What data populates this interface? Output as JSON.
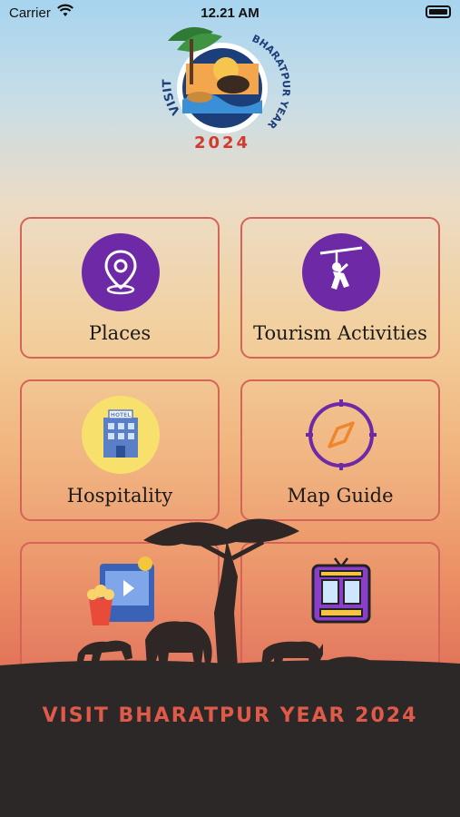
{
  "status_bar": {
    "carrier": "Carrier",
    "time": "12.21 AM"
  },
  "logo": {
    "text_arc": "VISIT BHARATPUR YEAR",
    "year": "2024",
    "icon": "bharatpur-logo"
  },
  "tiles": [
    {
      "label": "Places",
      "icon": "location-pin-icon"
    },
    {
      "label": "Tourism Activities",
      "icon": "zipline-icon"
    },
    {
      "label": "Hospitality",
      "icon": "hotel-icon"
    },
    {
      "label": "Map Guide",
      "icon": "compass-icon"
    },
    {
      "label": "",
      "icon": "entertainment-icon"
    },
    {
      "label": "",
      "icon": "bus-icon"
    }
  ],
  "footer": {
    "title": "VISIT BHARATPUR YEAR 2024"
  },
  "colors": {
    "accent": "#6e2aa6",
    "tile_border": "#d46458",
    "footer_bg": "#2d2828",
    "footer_text": "#e05a4a"
  }
}
